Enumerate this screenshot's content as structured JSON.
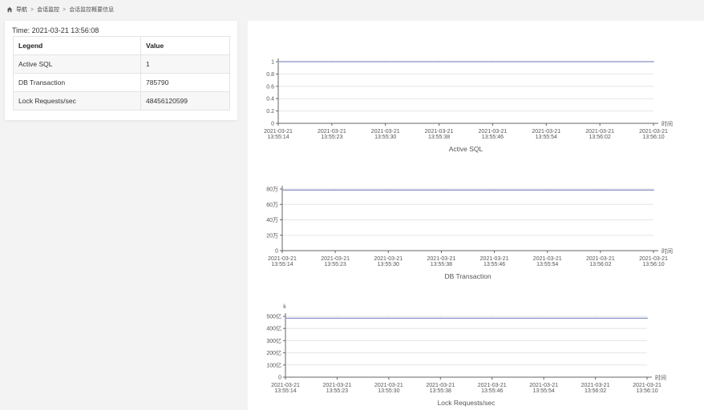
{
  "breadcrumb": {
    "home_icon": "home-icon",
    "items": [
      "导航",
      "会话监控",
      "会话监控概要信息"
    ]
  },
  "summary": {
    "time_label": "Time: 2021-03-21 13:56:08",
    "headers": [
      "Legend",
      "Value"
    ],
    "rows": [
      {
        "legend": "Active SQL",
        "value": "1"
      },
      {
        "legend": "DB Transaction",
        "value": "785790"
      },
      {
        "legend": "Lock Requests/sec",
        "value": "48456120599"
      }
    ]
  },
  "colors": {
    "line": "#8a94c8",
    "grid": "#e6e6e6",
    "axis": "#666666"
  },
  "chart_data": [
    {
      "type": "line",
      "title": "Active SQL",
      "x_axis_name": "时间",
      "unit_label": "",
      "x": [
        "2021-03-21 13:55:14",
        "2021-03-21 13:55:23",
        "2021-03-21 13:55:30",
        "2021-03-21 13:55:38",
        "2021-03-21 13:55:46",
        "2021-03-21 13:55:54",
        "2021-03-21 13:56:02",
        "2021-03-21 13:56:10"
      ],
      "y_ticks": [
        "0",
        "0.2",
        "0.4",
        "0.6",
        "0.8",
        "1"
      ],
      "ylim": [
        0,
        1
      ],
      "values": [
        1,
        1,
        1,
        1,
        1,
        1,
        1,
        1
      ]
    },
    {
      "type": "line",
      "title": "DB Transaction",
      "x_axis_name": "时间",
      "unit_label": "",
      "x": [
        "2021-03-21 13:55:14",
        "2021-03-21 13:55:23",
        "2021-03-21 13:55:30",
        "2021-03-21 13:55:38",
        "2021-03-21 13:55:46",
        "2021-03-21 13:55:54",
        "2021-03-21 13:56:02",
        "2021-03-21 13:56:10"
      ],
      "y_ticks": [
        "0",
        "20万",
        "40万",
        "60万",
        "80万"
      ],
      "ylim": [
        0,
        800000
      ],
      "values": [
        785790,
        785790,
        785790,
        785790,
        785790,
        785790,
        785790,
        785790
      ]
    },
    {
      "type": "line",
      "title": "Lock Requests/sec",
      "x_axis_name": "时间",
      "unit_label": "k",
      "x": [
        "2021-03-21 13:55:14",
        "2021-03-21 13:55:23",
        "2021-03-21 13:55:30",
        "2021-03-21 13:55:38",
        "2021-03-21 13:55:46",
        "2021-03-21 13:55:54",
        "2021-03-21 13:56:02",
        "2021-03-21 13:56:10"
      ],
      "y_ticks": [
        "0",
        "100亿",
        "200亿",
        "300亿",
        "400亿",
        "500亿"
      ],
      "ylim": [
        0,
        50000000000
      ],
      "values": [
        48456120599,
        48456120599,
        48456120599,
        48456120599,
        48456120599,
        48456120599,
        48456120599,
        48456120599
      ]
    }
  ]
}
